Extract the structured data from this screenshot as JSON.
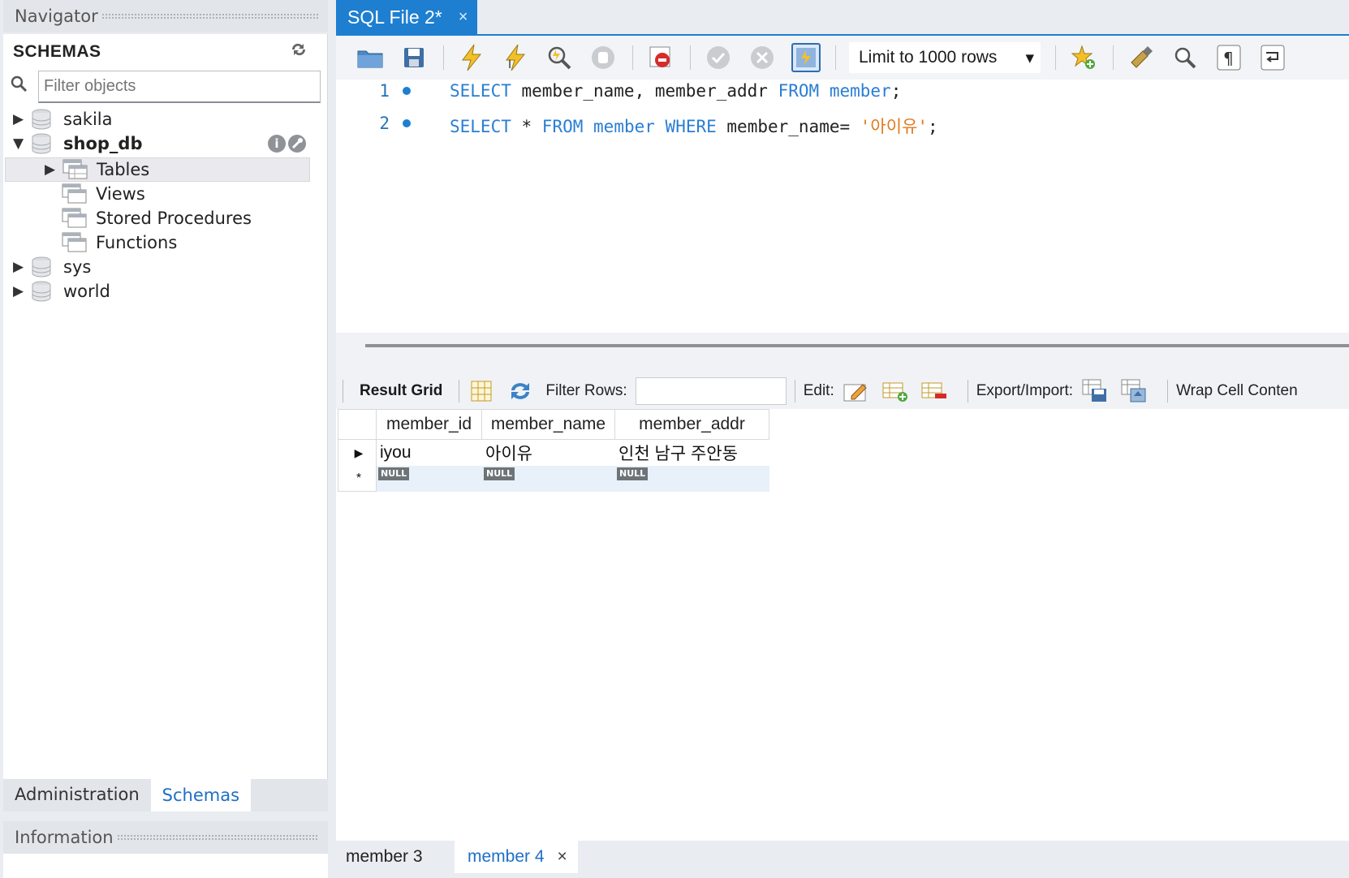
{
  "navigator": {
    "title": "Navigator",
    "schemas_label": "SCHEMAS",
    "filter_placeholder": "Filter objects",
    "tree": {
      "sakila": "sakila",
      "shop_db": "shop_db",
      "tables": "Tables",
      "views": "Views",
      "procs": "Stored Procedures",
      "functions": "Functions",
      "sys": "sys",
      "world": "world"
    },
    "info_btn": "i"
  },
  "left_tabs": {
    "admin": "Administration",
    "schemas": "Schemas"
  },
  "information": {
    "title": "Information"
  },
  "editor_tab": {
    "label": "SQL File 2*",
    "close": "×"
  },
  "toolbar": {
    "limit": "Limit to 1000 rows"
  },
  "editor": {
    "lines": [
      {
        "num": "1",
        "kw1": "SELECT",
        "t1": " member_name, member_addr ",
        "kw2": "FROM",
        "t2": " ",
        "kw3": "member",
        "t3": ";"
      },
      {
        "num": "2",
        "kw1": "SELECT",
        "t1": " * ",
        "kw2": "FROM",
        "t2": " ",
        "kw3": "member",
        "t3": " ",
        "kw4": "WHERE",
        "t4": " member_name= ",
        "str": "'아이유'",
        "t5": ";"
      }
    ]
  },
  "results_toolbar": {
    "result_grid": "Result Grid",
    "filter_rows": "Filter Rows:",
    "edit": "Edit:",
    "export": "Export/Import:",
    "wrap": "Wrap Cell Conten"
  },
  "grid": {
    "columns": [
      "member_id",
      "member_name",
      "member_addr"
    ],
    "rows": [
      [
        "iyou",
        "아이유",
        "인천 남구 주안동"
      ]
    ],
    "null": "NULL",
    "new_row_marker": "*"
  },
  "result_tabs": {
    "tab1": "member 3",
    "tab2": "member 4",
    "close": "×"
  },
  "colors": {
    "accent": "#1e7fd1",
    "keyword": "#2a7ed3",
    "string": "#e07a1f"
  }
}
